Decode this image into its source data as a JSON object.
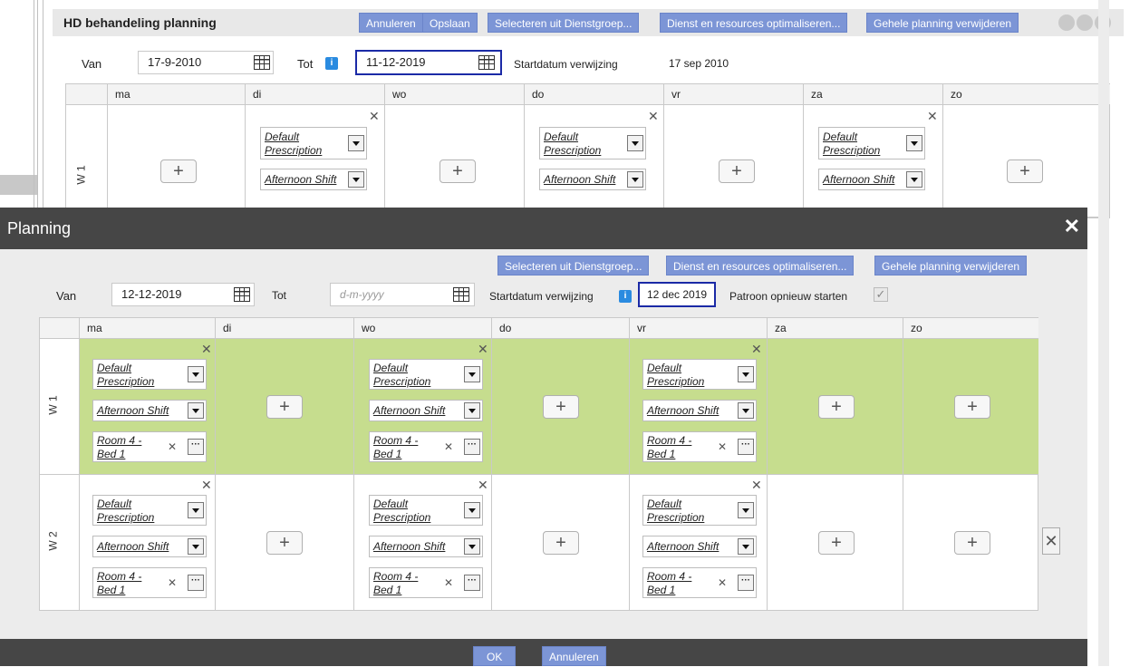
{
  "background": {
    "title": "HD behandeling planning",
    "buttons": [
      "Annuleren",
      "Opslaan",
      "Selecteren uit Dienstgroep...",
      "Dienst en resources optimaliseren...",
      "Gehele planning verwijderen"
    ],
    "van_label": "Van",
    "van_value": "17-9-2010",
    "tot_label": "Tot",
    "tot_value": "11-12-2019",
    "startdatum_label": "Startdatum verwijzing",
    "startdatum_value": "17 sep 2010",
    "days": [
      "ma",
      "di",
      "wo",
      "do",
      "vr",
      "za",
      "zo"
    ],
    "week": "W 1",
    "prescription": "Default Prescription",
    "prescription_l1": "Default",
    "prescription_l2": "Prescription",
    "shift": "Afternoon Shift"
  },
  "modal": {
    "title": "Planning",
    "close": "✕",
    "buttons": [
      "Selecteren uit Dienstgroep...",
      "Dienst en resources optimaliseren...",
      "Gehele planning verwijderen"
    ],
    "van_label": "Van",
    "van_value": "12-12-2019",
    "tot_label": "Tot",
    "tot_placeholder": "d-m-yyyy",
    "startdatum_label": "Startdatum verwijzing",
    "startdatum_value": "12 dec 2019",
    "patroon_label": "Patroon opnieuw starten",
    "days": [
      "ma",
      "di",
      "wo",
      "do",
      "vr",
      "za",
      "zo"
    ],
    "weeks": [
      "W 1",
      "W 2"
    ],
    "prescription_l1": "Default",
    "prescription_l2": "Prescription",
    "shift": "Afternoon Shift",
    "room_l1": "Room 4 -",
    "room_l2": "Bed 1",
    "ok": "OK",
    "annuleren": "Annuleren"
  },
  "icons": {
    "plus": "+",
    "remove": "✕",
    "more": "···",
    "check": "✓",
    "info": "i"
  },
  "colors": {
    "button": "#7c95d6",
    "green_row": "#c6dd8e",
    "titlebar": "#464646"
  }
}
